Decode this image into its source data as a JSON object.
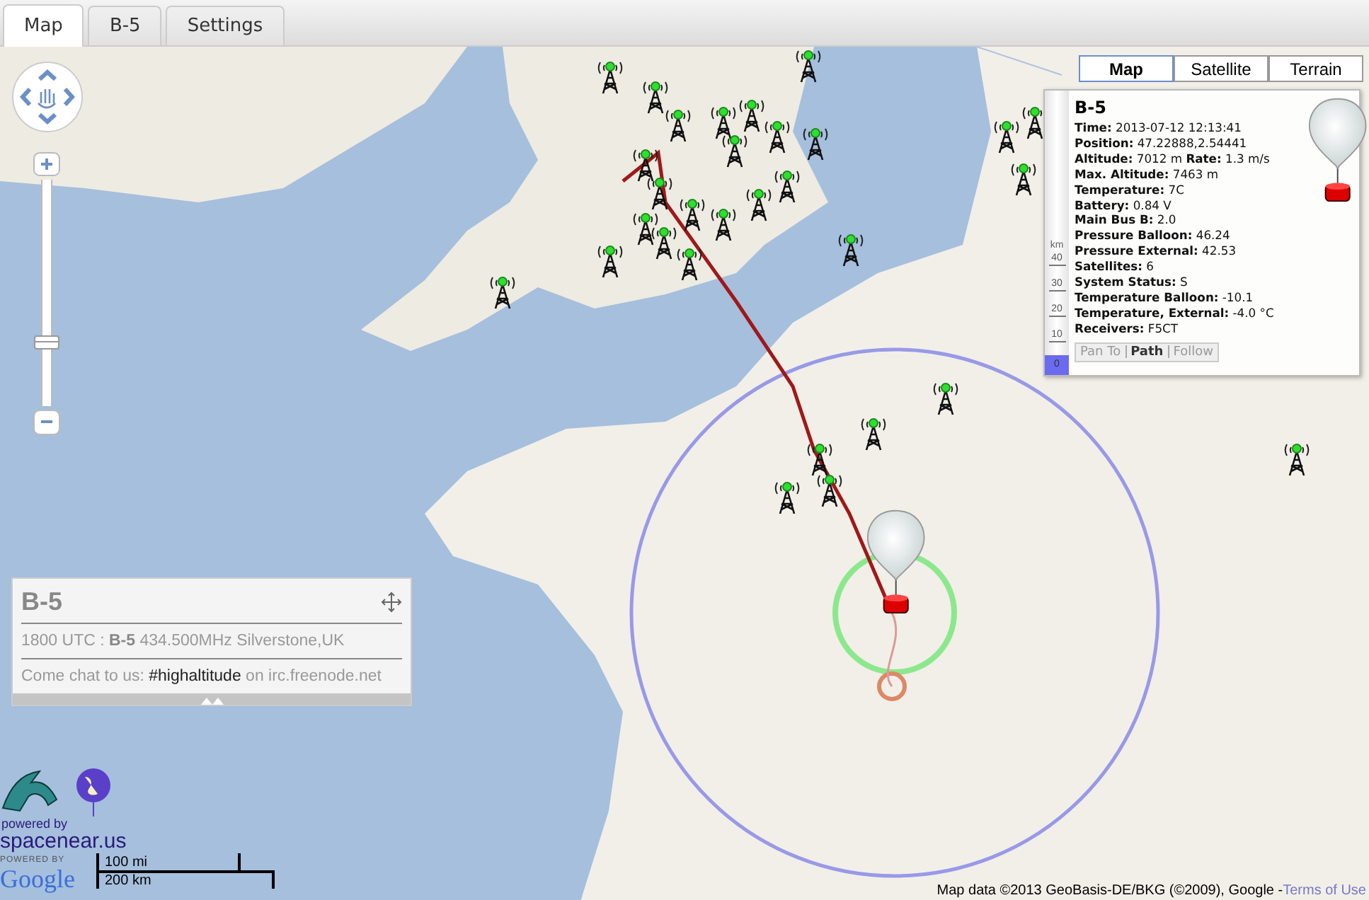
{
  "tabs": [
    {
      "label": "Map",
      "selected": true
    },
    {
      "label": "B-5",
      "selected": false
    },
    {
      "label": "Settings",
      "selected": false
    }
  ],
  "map_type_buttons": [
    {
      "label": "Map",
      "selected": true
    },
    {
      "label": "Satellite",
      "selected": false
    },
    {
      "label": "Terrain",
      "selected": false
    }
  ],
  "zoom": {
    "level": 0.27
  },
  "altitude_scale": {
    "unit": "km",
    "ticks": [
      "40",
      "30",
      "20",
      "10",
      "0"
    ]
  },
  "popup": {
    "title": "B-5",
    "lines": [
      "**Time:** 2013-07-12 12:13:41",
      "**Position:** 47.22888,2.54441",
      "**Altitude:** 7012 m **Rate:** 1.3 m/s",
      "**Max. Altitude:** 7463 m",
      "**Temperature:** 7C",
      "**Battery:** 0.84 V",
      "**Main Bus B:** 2.0",
      "**Pressure Balloon:** 46.24",
      "**Pressure External:** 42.53",
      "**Satellites:** 6",
      "**System Status:** S",
      "**Temperature Balloon:** -10.1",
      "**Temperature, External:** -4.0 °C",
      "**Receivers:** F5CT"
    ],
    "actions": [
      {
        "label": "Pan To",
        "selected": false
      },
      {
        "label": "Path",
        "selected": true
      },
      {
        "label": "Follow",
        "selected": false
      }
    ]
  },
  "info_panel": {
    "title": "B-5",
    "schedule": "1800 UTC : **B-5** 434.500MHz Silverstone,UK",
    "chat": "Come chat to us: **#highaltitude** on irc.freenode.net"
  },
  "branding": {
    "tagline": "powered by",
    "site": "spacenear.us",
    "google_caption": "POWERED BY",
    "google": "Google"
  },
  "scale": {
    "imperial": "100 mi",
    "metric": "200 km"
  },
  "attribution": {
    "text": "Map data ©2013 GeoBasis-DE/BKG (©2009), Google - ",
    "link": "Terms of Use"
  }
}
